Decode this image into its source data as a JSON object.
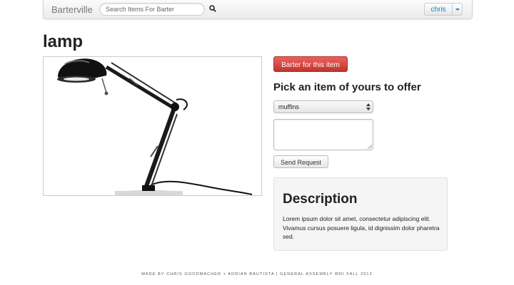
{
  "navbar": {
    "brand": "Barterville",
    "search_placeholder": "Search Items For Barter",
    "user_name": "chris"
  },
  "item": {
    "title": "lamp",
    "image_icon": "desk-lamp-image"
  },
  "barter": {
    "button_label": "Barter for this item",
    "offer_heading": "Pick an item of yours to offer",
    "selected_item": "muffins",
    "message_value": "",
    "send_label": "Send Request"
  },
  "description": {
    "heading": "Description",
    "text": "Lorem ipsum dolor sit amet, consectetur adipiscing elit. Vivamus cursus posuere ligula, id dignissim dolor pharetra sed."
  },
  "footer": {
    "credit": "MADE BY CHRIS GOODMACHER + ADRIAN BAUTISTA | GENERAL ASSEMBLY WDI FALL 2012"
  },
  "colors": {
    "danger": "#da4f49",
    "link": "#0088cc",
    "panel": "#f5f5f5"
  }
}
